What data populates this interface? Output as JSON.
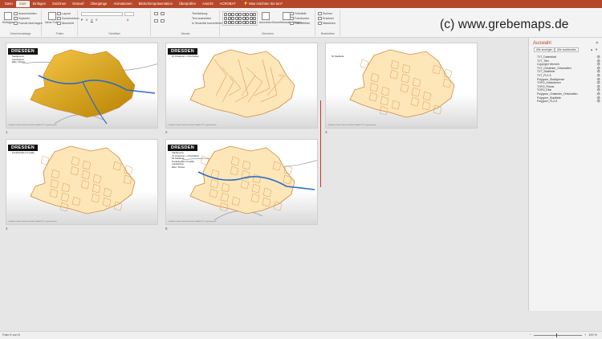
{
  "tabs": [
    "Datei",
    "Start",
    "Einfügen",
    "Zeichnen",
    "Entwurf",
    "Übergänge",
    "Animationen",
    "Bildschirmpräsentation",
    "Überprüfen",
    "Ansicht",
    "ACROBAT"
  ],
  "active_tab_index": 1,
  "tell_me": "Was möchten Sie tun?",
  "ribbon": {
    "clipboard": {
      "label": "Zwischenablage",
      "paste": "Einfügen",
      "cut": "Ausschneiden",
      "copy": "Kopieren",
      "format": "Format übertragen"
    },
    "slides": {
      "label": "Folien",
      "new": "Neue Folie",
      "layout": "Layout",
      "reset": "Zurücksetzen",
      "section": "Abschnitt"
    },
    "font": {
      "label": "Schriftart"
    },
    "paragraph": {
      "label": "Absatz"
    },
    "drawing": {
      "label": "Zeichnen",
      "arrange": "Anordnen",
      "quick_styles": "Schnellformat-vorlagen",
      "fill": "Fülleffekt",
      "outline": "Formkontur",
      "effects": "Formeffekte"
    },
    "editing": {
      "label": "Bearbeiten",
      "find": "Suchen",
      "replace": "Ersetzen",
      "select": "Markieren"
    },
    "text_dir": "Textrichtung",
    "align_text": "Text ausrichten",
    "smartart": "In SmartArt konvertieren"
  },
  "watermark": "(c) www.grebemaps.de",
  "slides": [
    {
      "num": "1",
      "title": "DRESDEN",
      "lines": [
        "Stadtgrenze",
        "Autobahnen",
        "Elbe / Flüsse"
      ]
    },
    {
      "num": "2",
      "title": "DRESDEN",
      "lines": [
        "10 Ortsämter + Ortschaften"
      ]
    },
    {
      "num": "3",
      "title": "",
      "lines": [
        "64 Stadtteile"
      ]
    },
    {
      "num": "4",
      "title": "DRESDEN",
      "lines": [
        "Postleitzahlen 5-stellig"
      ]
    },
    {
      "num": "5",
      "title": "DRESDEN",
      "lines": [
        "Stadtgrenze",
        "10 Ortsämter + Ortschaften",
        "64 Stadtteile",
        "Postleitzahlen 5-stellig",
        "Autobahnen",
        "Elbe / Flüsse"
      ]
    }
  ],
  "slide_footer": "Stadtkarte Dresden Ortsamt Ortschaften Stadtteile PLZ - (c) grebemaps.de",
  "selection_pane": {
    "title": "Auswahl",
    "show_all": "Alle anzeigen",
    "hide_all": "Alle ausblenden",
    "items": [
      "TXT_Datenblatt",
      "TXT_Titel",
      "Copyright Vermerk",
      "TXT_Ortsämter_Ortschaften",
      "TXT_Stadtteile",
      "TXT_PLZ-5",
      "Polygone_Stadtgrenze",
      "TOPO_Autobahnen",
      "TOPO_Flüsse",
      "TOPO_Elbe",
      "Polygone_Ortsämter_Ortschaften",
      "Polygone_Stadtteile",
      "Polygone_PLZ-5"
    ]
  },
  "status": {
    "slide_info": "Folie 5 von 5",
    "zoom": "100 %"
  },
  "colors": {
    "accent": "#b7472a",
    "map_gold": "#e0a000",
    "map_pale": "#fde6b8",
    "map_outline": "#d08a3a",
    "river": "#2b6cc4",
    "highway": "#9aa5b1"
  }
}
